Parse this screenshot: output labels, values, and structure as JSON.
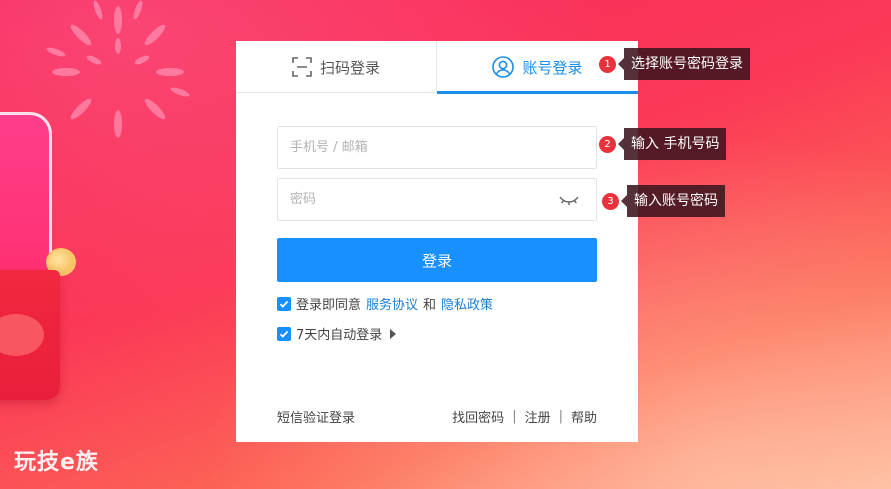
{
  "tabs": {
    "qr_label": "扫码登录",
    "account_label": "账号登录"
  },
  "form": {
    "phone_placeholder": "手机号 / 邮箱",
    "phone_value": "",
    "password_placeholder": "密码",
    "password_value": "",
    "login_label": "登录"
  },
  "agreement": {
    "prefix": "登录即同意",
    "service_link": "服务协议",
    "and": "和",
    "privacy_link": "隐私政策",
    "checked": true
  },
  "auto_login": {
    "label": "7天内自动登录",
    "checked": true
  },
  "footer": {
    "sms_login": "短信验证登录",
    "find_password": "找回密码",
    "register": "注册",
    "help": "帮助",
    "separator": "|"
  },
  "steps": [
    {
      "num": "1",
      "text": "选择账号密码登录"
    },
    {
      "num": "2",
      "text": "输入 手机号码"
    },
    {
      "num": "3",
      "text": "输入账号密码"
    }
  ],
  "brand": {
    "logo_text": "玩技e族"
  },
  "colors": {
    "accent": "#1890ff",
    "step_badge": "#e8323c",
    "background_top": "#f7255c",
    "background_bottom": "#ffb79a"
  },
  "icons": {
    "qr_tab": "scan-frame-icon",
    "account_tab": "user-circle-icon",
    "password_toggle": "eye-closed-icon",
    "checkbox": "checkmark-icon",
    "expand": "caret-right-icon"
  }
}
